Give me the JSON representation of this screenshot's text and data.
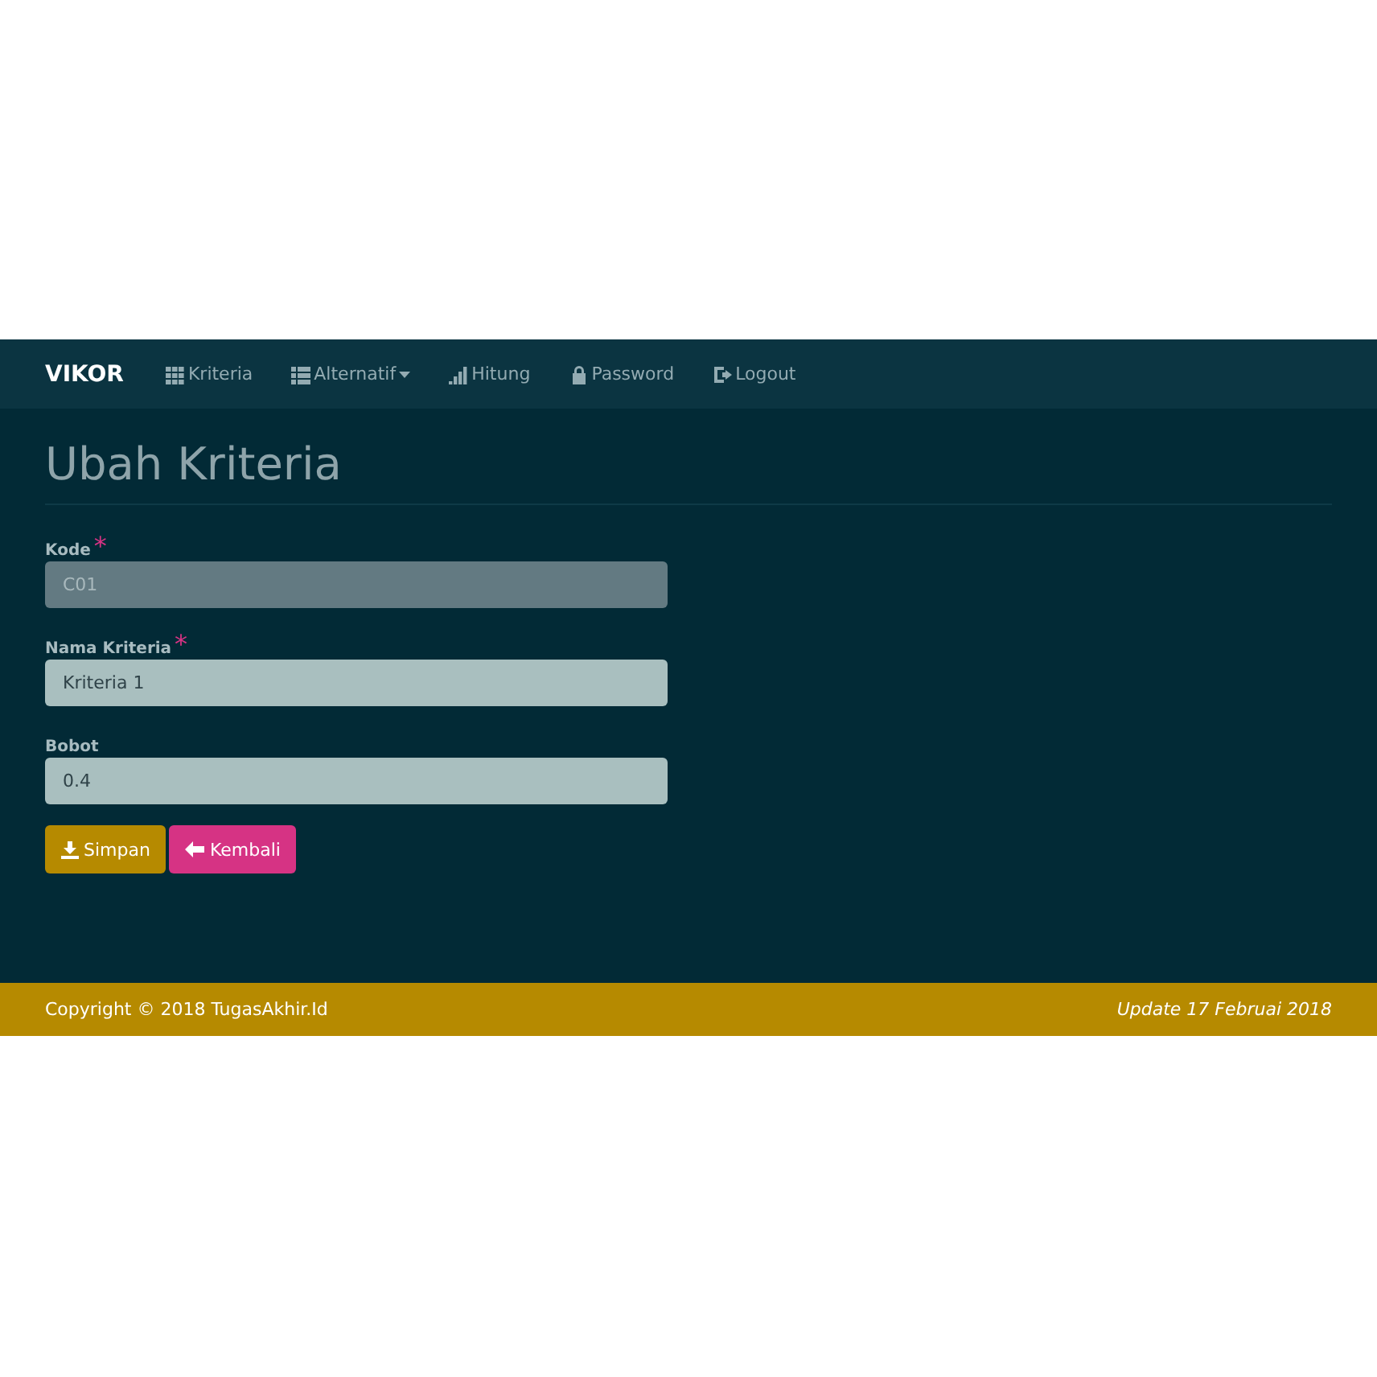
{
  "navbar": {
    "brand": "VIKOR",
    "items": [
      {
        "label": "Kriteria",
        "kind": "grid",
        "dropdown": false
      },
      {
        "label": "Alternatif",
        "kind": "list",
        "dropdown": true
      },
      {
        "label": "Hitung",
        "kind": "signal",
        "dropdown": false
      },
      {
        "label": "Password",
        "kind": "lock",
        "dropdown": false
      },
      {
        "label": "Logout",
        "kind": "logout",
        "dropdown": false
      }
    ]
  },
  "page": {
    "title": "Ubah Kriteria"
  },
  "form": {
    "fields": [
      {
        "label": "Kode",
        "mark": "*",
        "value": "C01",
        "disabled": true
      },
      {
        "label": "Nama Kriteria",
        "mark": "*",
        "value": "Kriteria 1",
        "disabled": false
      },
      {
        "label": "Bobot",
        "value": "0.4",
        "disabled": false
      }
    ],
    "buttons": [
      {
        "label": "Simpan",
        "kind": "save"
      },
      {
        "label": "Kembali",
        "kind": "back"
      }
    ]
  },
  "footer": {
    "left": "Copyright © 2018 TugasAkhir.Id",
    "right": "Update 17 Februai 2018"
  }
}
